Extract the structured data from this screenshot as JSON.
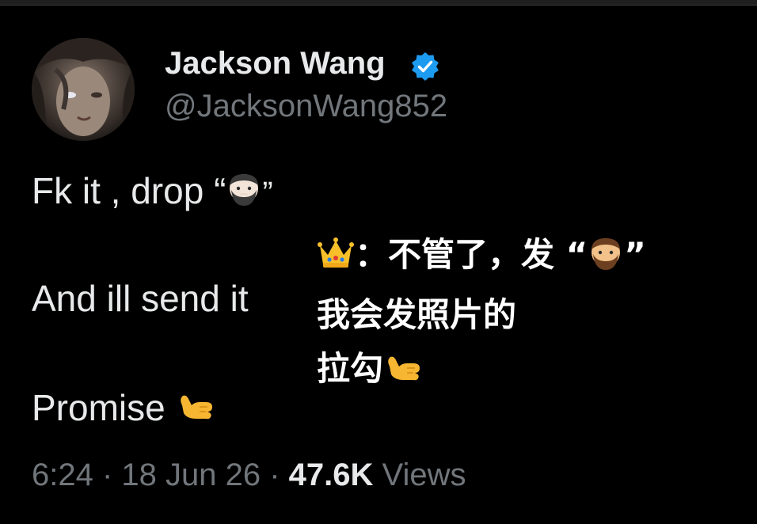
{
  "author": {
    "display_name": "Jackson Wang",
    "handle": "@JacksonWang852",
    "verified_icon": "verified-badge-icon"
  },
  "tweet": {
    "line1_text": "Fk it , drop “",
    "line1_close": "”",
    "line2_text": "And ill send it",
    "line3_text": "Promise",
    "zh_line1_colon": "：不管了，发 “",
    "zh_line1_close": "”",
    "zh_line2": "我会发照片的",
    "zh_line3": "拉勾",
    "emojis": [
      "bearded-man-light-emoji",
      "crown-emoji",
      "bearded-man-medium-emoji",
      "call-me-hand-emoji"
    ]
  },
  "meta": {
    "time": "6:24",
    "sep1": " · ",
    "date": "18 Jun 26",
    "sep2": " · ",
    "views_count": "47.6K",
    "views_label": " Views"
  },
  "colors": {
    "background": "#000000",
    "text": "#e7e9ea",
    "muted": "#71767b",
    "verified": "#1d9bf0"
  }
}
